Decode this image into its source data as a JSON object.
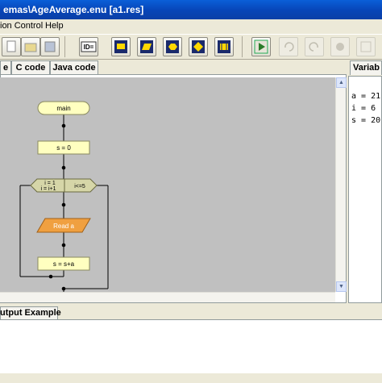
{
  "window": {
    "title": "emas\\AgeAverage.enu [a1.res]"
  },
  "menu": {
    "items": [
      "ion Control",
      "Help"
    ]
  },
  "toolbar": {
    "id_label": "ID=",
    "icons": [
      "new-icon",
      "open-icon",
      "save-icon",
      "id-assign-icon",
      "process-block-icon",
      "io-block-icon",
      "loop-block-icon",
      "decision-block-icon",
      "subroutine-block-icon",
      "run-icon",
      "undo-icon",
      "redo-icon",
      "stop-icon"
    ]
  },
  "tabs": [
    {
      "label": "e"
    },
    {
      "label": "C code"
    },
    {
      "label": "Java code"
    }
  ],
  "variables": {
    "title": "Variab",
    "lines": [
      "a = 21",
      "i = 6",
      "s = 20"
    ]
  },
  "flowchart": {
    "start": "main",
    "assign": "s = 0",
    "loop_init": "i = 1",
    "loop_step": "i = i+1",
    "loop_cond": "i<=5",
    "read": "Read a",
    "sum": "s = s+a"
  },
  "output": {
    "tab_label": "utput Example"
  },
  "colors": {
    "accent": "#0a5fd8",
    "block_fill": "#ffffc0",
    "loop_fill": "#d6d6a8",
    "read_fill": "#f0a040"
  }
}
